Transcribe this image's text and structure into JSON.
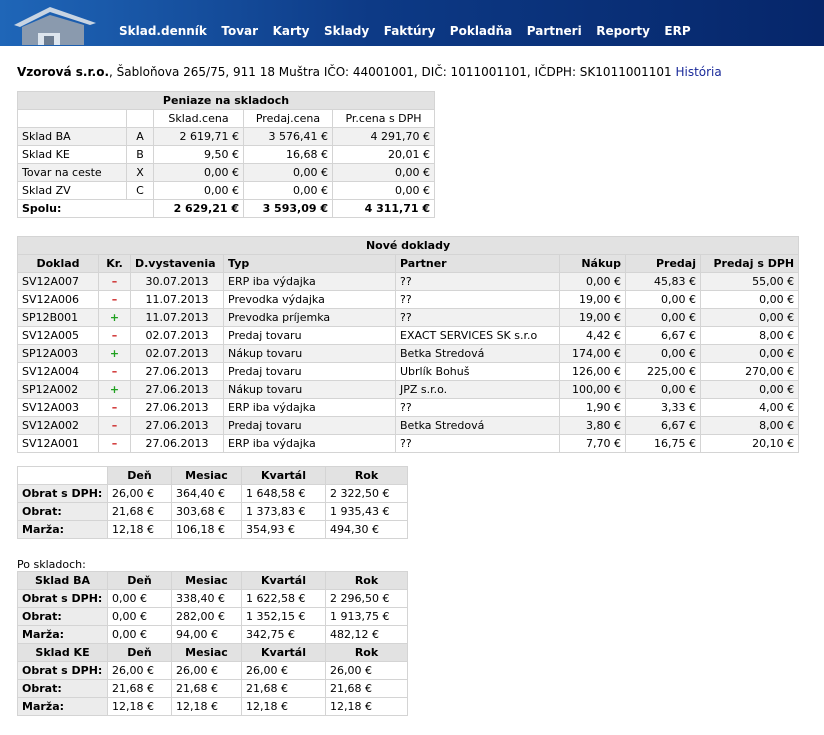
{
  "nav": [
    "Sklad.denník",
    "Tovar",
    "Karty",
    "Sklady",
    "Faktúry",
    "Pokladňa",
    "Partneri",
    "Reporty",
    "ERP"
  ],
  "company": {
    "name": "Vzorová s.r.o.",
    "details": ", Šabloňova 265/75, 911 18 Muštra IČO: 44001001, DIČ: 1011001101, IČDPH: SK1011001101 ",
    "history_link": "História"
  },
  "stock": {
    "title": "Peniaze na skladoch",
    "headers": [
      "Sklad.cena",
      "Predaj.cena",
      "Pr.cena s DPH"
    ],
    "rows": [
      {
        "name": "Sklad BA",
        "code": "A",
        "cost": "2 619,71 €",
        "sale": "3 576,41 €",
        "vat": "4 291,70 €"
      },
      {
        "name": "Sklad KE",
        "code": "B",
        "cost": "9,50 €",
        "sale": "16,68 €",
        "vat": "20,01 €"
      },
      {
        "name": "Tovar na ceste",
        "code": "X",
        "cost": "0,00 €",
        "sale": "0,00 €",
        "vat": "0,00 €"
      },
      {
        "name": "Sklad ZV",
        "code": "C",
        "cost": "0,00 €",
        "sale": "0,00 €",
        "vat": "0,00 €"
      }
    ],
    "total": {
      "label": "Spolu:",
      "cost": "2 629,21 €",
      "sale": "3 593,09 €",
      "vat": "4 311,71 €"
    }
  },
  "docs": {
    "title": "Nové doklady",
    "headers": [
      "Doklad",
      "Kr.",
      "D.vystavenia",
      "Typ",
      "Partner",
      "Nákup",
      "Predaj",
      "Predaj s DPH"
    ],
    "rows": [
      {
        "doc": "SV12A007",
        "kr": "–",
        "date": "30.07.2013",
        "type": "ERP iba výdajka",
        "partner": "??",
        "buy": "0,00 €",
        "sell": "45,83 €",
        "vat": "55,00 €"
      },
      {
        "doc": "SV12A006",
        "kr": "–",
        "date": "11.07.2013",
        "type": "Prevodka výdajka",
        "partner": "??",
        "buy": "19,00 €",
        "sell": "0,00 €",
        "vat": "0,00 €"
      },
      {
        "doc": "SP12B001",
        "kr": "+",
        "date": "11.07.2013",
        "type": "Prevodka príjemka",
        "partner": "??",
        "buy": "19,00 €",
        "sell": "0,00 €",
        "vat": "0,00 €"
      },
      {
        "doc": "SV12A005",
        "kr": "–",
        "date": "02.07.2013",
        "type": "Predaj tovaru",
        "partner": "EXACT SERVICES SK s.r.o",
        "buy": "4,42 €",
        "sell": "6,67 €",
        "vat": "8,00 €"
      },
      {
        "doc": "SP12A003",
        "kr": "+",
        "date": "02.07.2013",
        "type": "Nákup tovaru",
        "partner": "Betka Stredová",
        "buy": "174,00 €",
        "sell": "0,00 €",
        "vat": "0,00 €"
      },
      {
        "doc": "SV12A004",
        "kr": "–",
        "date": "27.06.2013",
        "type": "Predaj tovaru",
        "partner": "Ubrlík Bohuš",
        "buy": "126,00 €",
        "sell": "225,00 €",
        "vat": "270,00 €"
      },
      {
        "doc": "SP12A002",
        "kr": "+",
        "date": "27.06.2013",
        "type": "Nákup tovaru",
        "partner": "JPZ s.r.o.",
        "buy": "100,00 €",
        "sell": "0,00 €",
        "vat": "0,00 €"
      },
      {
        "doc": "SV12A003",
        "kr": "–",
        "date": "27.06.2013",
        "type": "ERP iba výdajka",
        "partner": "??",
        "buy": "1,90 €",
        "sell": "3,33 €",
        "vat": "4,00 €"
      },
      {
        "doc": "SV12A002",
        "kr": "–",
        "date": "27.06.2013",
        "type": "Predaj tovaru",
        "partner": "Betka Stredová",
        "buy": "3,80 €",
        "sell": "6,67 €",
        "vat": "8,00 €"
      },
      {
        "doc": "SV12A001",
        "kr": "–",
        "date": "27.06.2013",
        "type": "ERP iba výdajka",
        "partner": "??",
        "buy": "7,70 €",
        "sell": "16,75 €",
        "vat": "20,10 €"
      }
    ]
  },
  "turnover": {
    "headers": [
      "Deň",
      "Mesiac",
      "Kvartál",
      "Rok"
    ],
    "rows": [
      {
        "label": "Obrat s DPH:",
        "values": [
          "26,00 €",
          "364,40 €",
          "1 648,58 €",
          "2 322,50 €"
        ]
      },
      {
        "label": "Obrat:",
        "values": [
          "21,68 €",
          "303,68 €",
          "1 373,83 €",
          "1 935,43 €"
        ]
      },
      {
        "label": "Marža:",
        "values": [
          "12,18 €",
          "106,18 €",
          "354,93 €",
          "494,30 €"
        ]
      }
    ]
  },
  "by_warehouse": {
    "caption": "Po skladoch:",
    "warehouses": [
      {
        "name": "Sklad BA",
        "headers": [
          "Deň",
          "Mesiac",
          "Kvartál",
          "Rok"
        ],
        "rows": [
          {
            "label": "Obrat s DPH:",
            "values": [
              "0,00 €",
              "338,40 €",
              "1 622,58 €",
              "2 296,50 €"
            ]
          },
          {
            "label": "Obrat:",
            "values": [
              "0,00 €",
              "282,00 €",
              "1 352,15 €",
              "1 913,75 €"
            ]
          },
          {
            "label": "Marža:",
            "values": [
              "0,00 €",
              "94,00 €",
              "342,75 €",
              "482,12 €"
            ]
          }
        ]
      },
      {
        "name": "Sklad KE",
        "headers": [
          "Deň",
          "Mesiac",
          "Kvartál",
          "Rok"
        ],
        "rows": [
          {
            "label": "Obrat s DPH:",
            "values": [
              "26,00 €",
              "26,00 €",
              "26,00 €",
              "26,00 €"
            ]
          },
          {
            "label": "Obrat:",
            "values": [
              "21,68 €",
              "21,68 €",
              "21,68 €",
              "21,68 €"
            ]
          },
          {
            "label": "Marža:",
            "values": [
              "12,18 €",
              "12,18 €",
              "12,18 €",
              "12,18 €"
            ]
          }
        ]
      }
    ]
  }
}
